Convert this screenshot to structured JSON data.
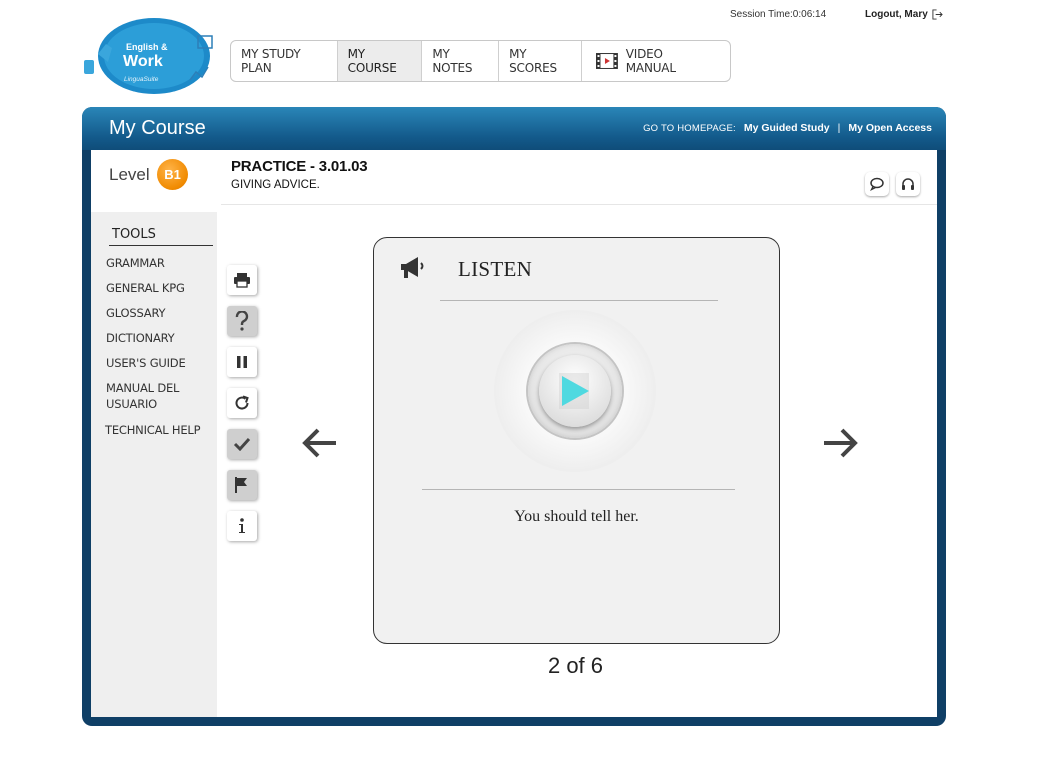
{
  "session": {
    "label": "Session Time:0:06:14",
    "logout": "Logout, Mary"
  },
  "logo": {
    "line1": "English &",
    "line2": "Work",
    "line3": "LinguaSuite"
  },
  "topnav": [
    {
      "label": "MY STUDY PLAN",
      "active": false
    },
    {
      "label": "MY COURSE",
      "active": true
    },
    {
      "label": "MY NOTES",
      "active": false
    },
    {
      "label": "MY SCORES",
      "active": false
    },
    {
      "label": "VIDEO MANUAL",
      "active": false,
      "icon": "film-icon"
    }
  ],
  "frame": {
    "title": "My Course",
    "homepage_label": "GO TO HOMEPAGE:",
    "guided_study": "My Guided Study",
    "separator": "|",
    "open_access": "My Open Access"
  },
  "level": {
    "label": "Level",
    "badge": "B1",
    "badge_color": "#f08a00"
  },
  "tools": {
    "title": "TOOLS",
    "items": [
      "GRAMMAR",
      "GENERAL KPG",
      "GLOSSARY",
      "DICTIONARY",
      "USER'S GUIDE",
      "MANUAL DEL USUARIO",
      "TECHNICAL HELP"
    ]
  },
  "practice": {
    "title": "PRACTICE - 3.01.03",
    "subtitle": "GIVING ADVICE."
  },
  "header_icons": [
    "chat-icon",
    "headphones-icon"
  ],
  "side_icons": [
    "print-icon",
    "help-icon",
    "pause-icon",
    "refresh-icon",
    "check-icon",
    "flag-icon",
    "info-icon"
  ],
  "card": {
    "title": "LISTEN",
    "sentence": "You should tell her.",
    "play_color": "#4fd9e0"
  },
  "pager": "2 of 6"
}
